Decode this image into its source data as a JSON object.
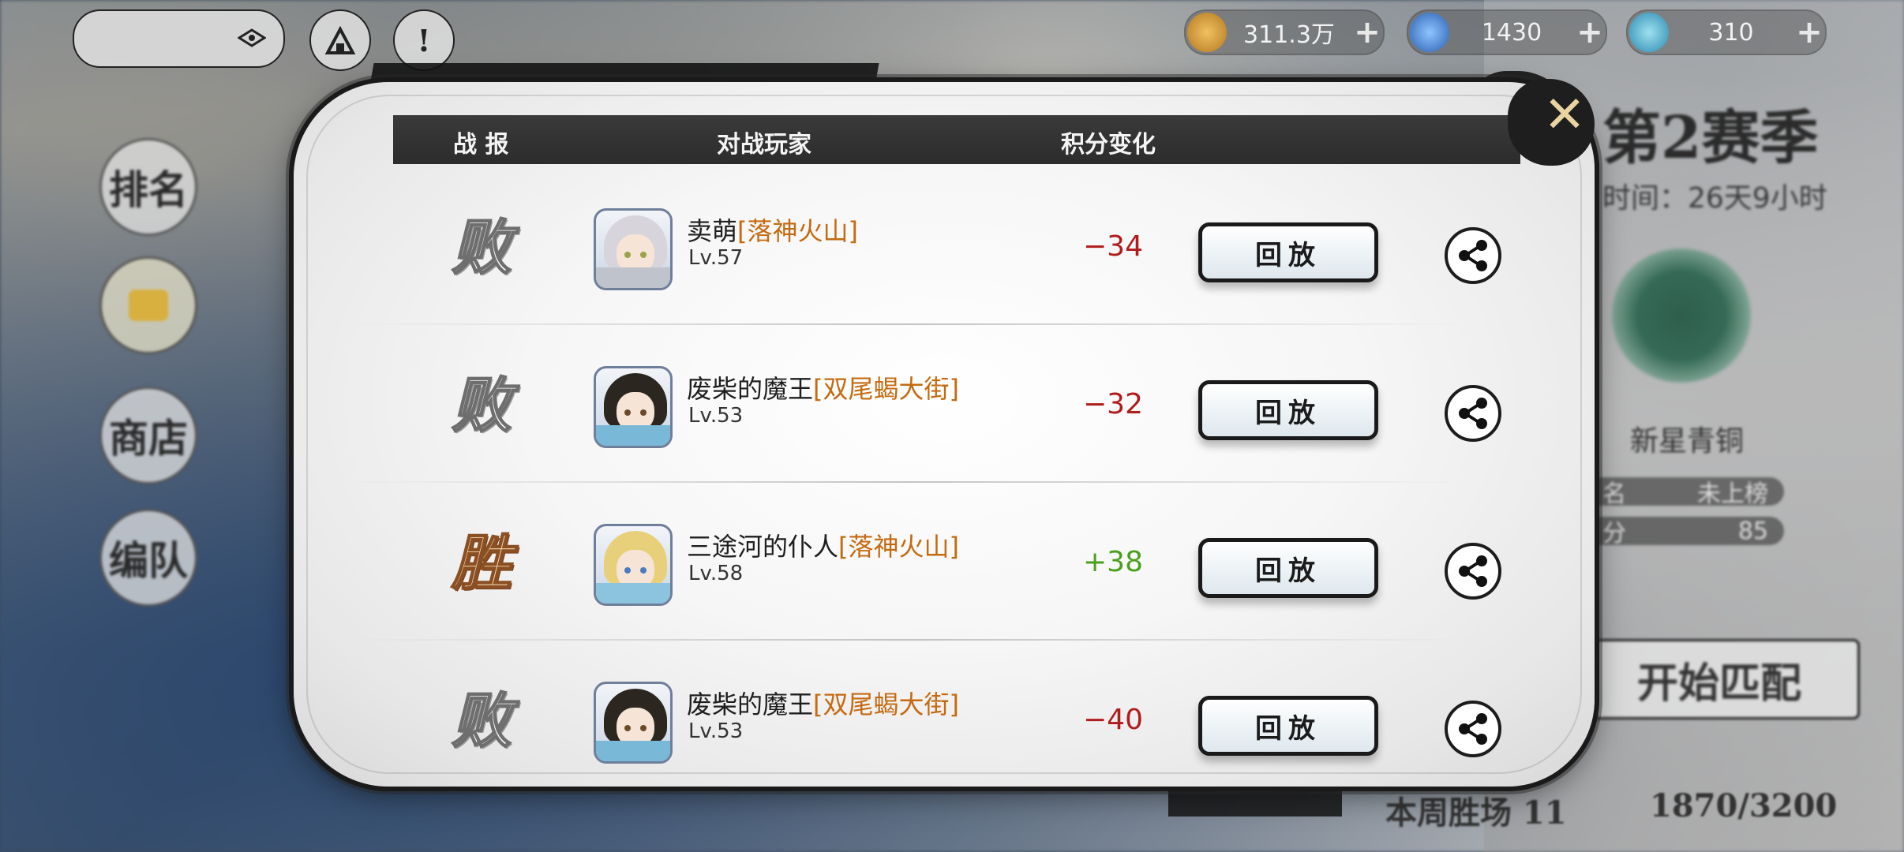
{
  "hud": {
    "currencies": [
      {
        "icon": "gold-coin-icon",
        "value": "311.3万",
        "color": "#c98a2a"
      },
      {
        "icon": "blue-crystal-icon",
        "value": "1430",
        "color": "#3a7fd0"
      },
      {
        "icon": "ticket-icon",
        "value": "310",
        "color": "#3aa3c8"
      }
    ],
    "hud_info_glyph": "!",
    "plus_glyph": "+"
  },
  "side_menu": [
    "排名",
    "",
    "商店",
    "编队"
  ],
  "right_panel": {
    "season": "第2赛季",
    "time_left": "时间：26天9小时",
    "rank_name": "新星青铜",
    "rank_rows": [
      {
        "label": "名",
        "value": "未上榜"
      },
      {
        "label": "分",
        "value": "85"
      }
    ],
    "match_button": "开始匹配",
    "weekly": "本周胜场  11",
    "progress": "1870/3200"
  },
  "modal": {
    "headers": {
      "result": "战 报",
      "opponent": "对战玩家",
      "score_change": "积分变化"
    },
    "close_glyph": "✕",
    "replay_label": "回放",
    "rows": [
      {
        "result": "败",
        "outcome": "lose",
        "name": "卖萌",
        "guild": "[落神火山]",
        "level": "Lv.57",
        "score": "−34",
        "avatar": {
          "hair": "#d8d4dc",
          "eye": "#9aa34a",
          "body": "#bfc3cc"
        }
      },
      {
        "result": "败",
        "outcome": "lose",
        "name": "废柴的魔王",
        "guild": "[双尾蝎大街]",
        "level": "Lv.53",
        "score": "−32",
        "avatar": {
          "hair": "#2b2620",
          "eye": "#6a4a2a",
          "body": "#7ab8d8"
        }
      },
      {
        "result": "胜",
        "outcome": "win",
        "name": "三途河的仆人",
        "guild": "[落神火山]",
        "level": "Lv.58",
        "score": "+38",
        "avatar": {
          "hair": "#e8d07a",
          "eye": "#4a7ac0",
          "body": "#8cc4e0"
        }
      },
      {
        "result": "败",
        "outcome": "lose",
        "name": "废柴的魔王",
        "guild": "[双尾蝎大街]",
        "level": "Lv.53",
        "score": "−40",
        "avatar": {
          "hair": "#2b2620",
          "eye": "#6a4a2a",
          "body": "#7ab8d8"
        }
      }
    ]
  }
}
